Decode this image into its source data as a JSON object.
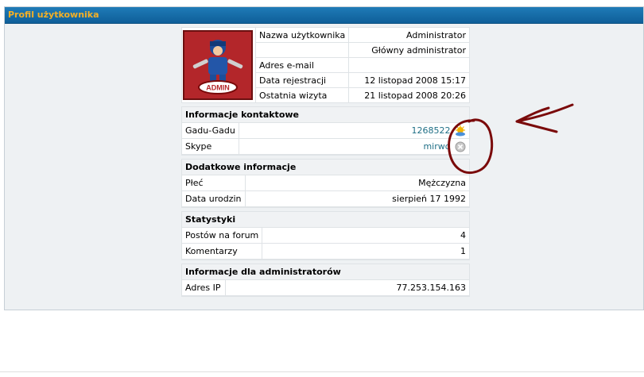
{
  "panel": {
    "title": "Profil użytkownika"
  },
  "profile": {
    "rows": [
      {
        "label": "Nazwa użytkownika",
        "value": "Administrator"
      },
      {
        "label": "",
        "value": "Główny administrator"
      },
      {
        "label": "Adres e-mail",
        "value": ""
      },
      {
        "label": "Data rejestracji",
        "value": "12 listopad 2008 15:17"
      },
      {
        "label": "Ostatnia wizyta",
        "value": "21 listopad 2008 20:26"
      }
    ],
    "avatar_badge": "ADMIN"
  },
  "contact": {
    "title": "Informacje kontaktowe",
    "gadu_label": "Gadu-Gadu",
    "gadu_value": "1268522",
    "skype_label": "Skype",
    "skype_value": "mirwo"
  },
  "extra": {
    "title": "Dodatkowe informacje",
    "gender_label": "Płeć",
    "gender_value": "Mężczyzna",
    "birth_label": "Data urodzin",
    "birth_value": "sierpień 17 1992"
  },
  "stats": {
    "title": "Statystyki",
    "posts_label": "Postów na forum",
    "posts_value": "4",
    "comments_label": "Komentarzy",
    "comments_value": "1"
  },
  "admin": {
    "title": "Informacje dla administratorów",
    "ip_label": "Adres IP",
    "ip_value": "77.253.154.163"
  },
  "colors": {
    "header": "#1f7bb7",
    "title": "#f5b026",
    "link": "#1f6f86",
    "annotation": "#7a0a0a"
  }
}
